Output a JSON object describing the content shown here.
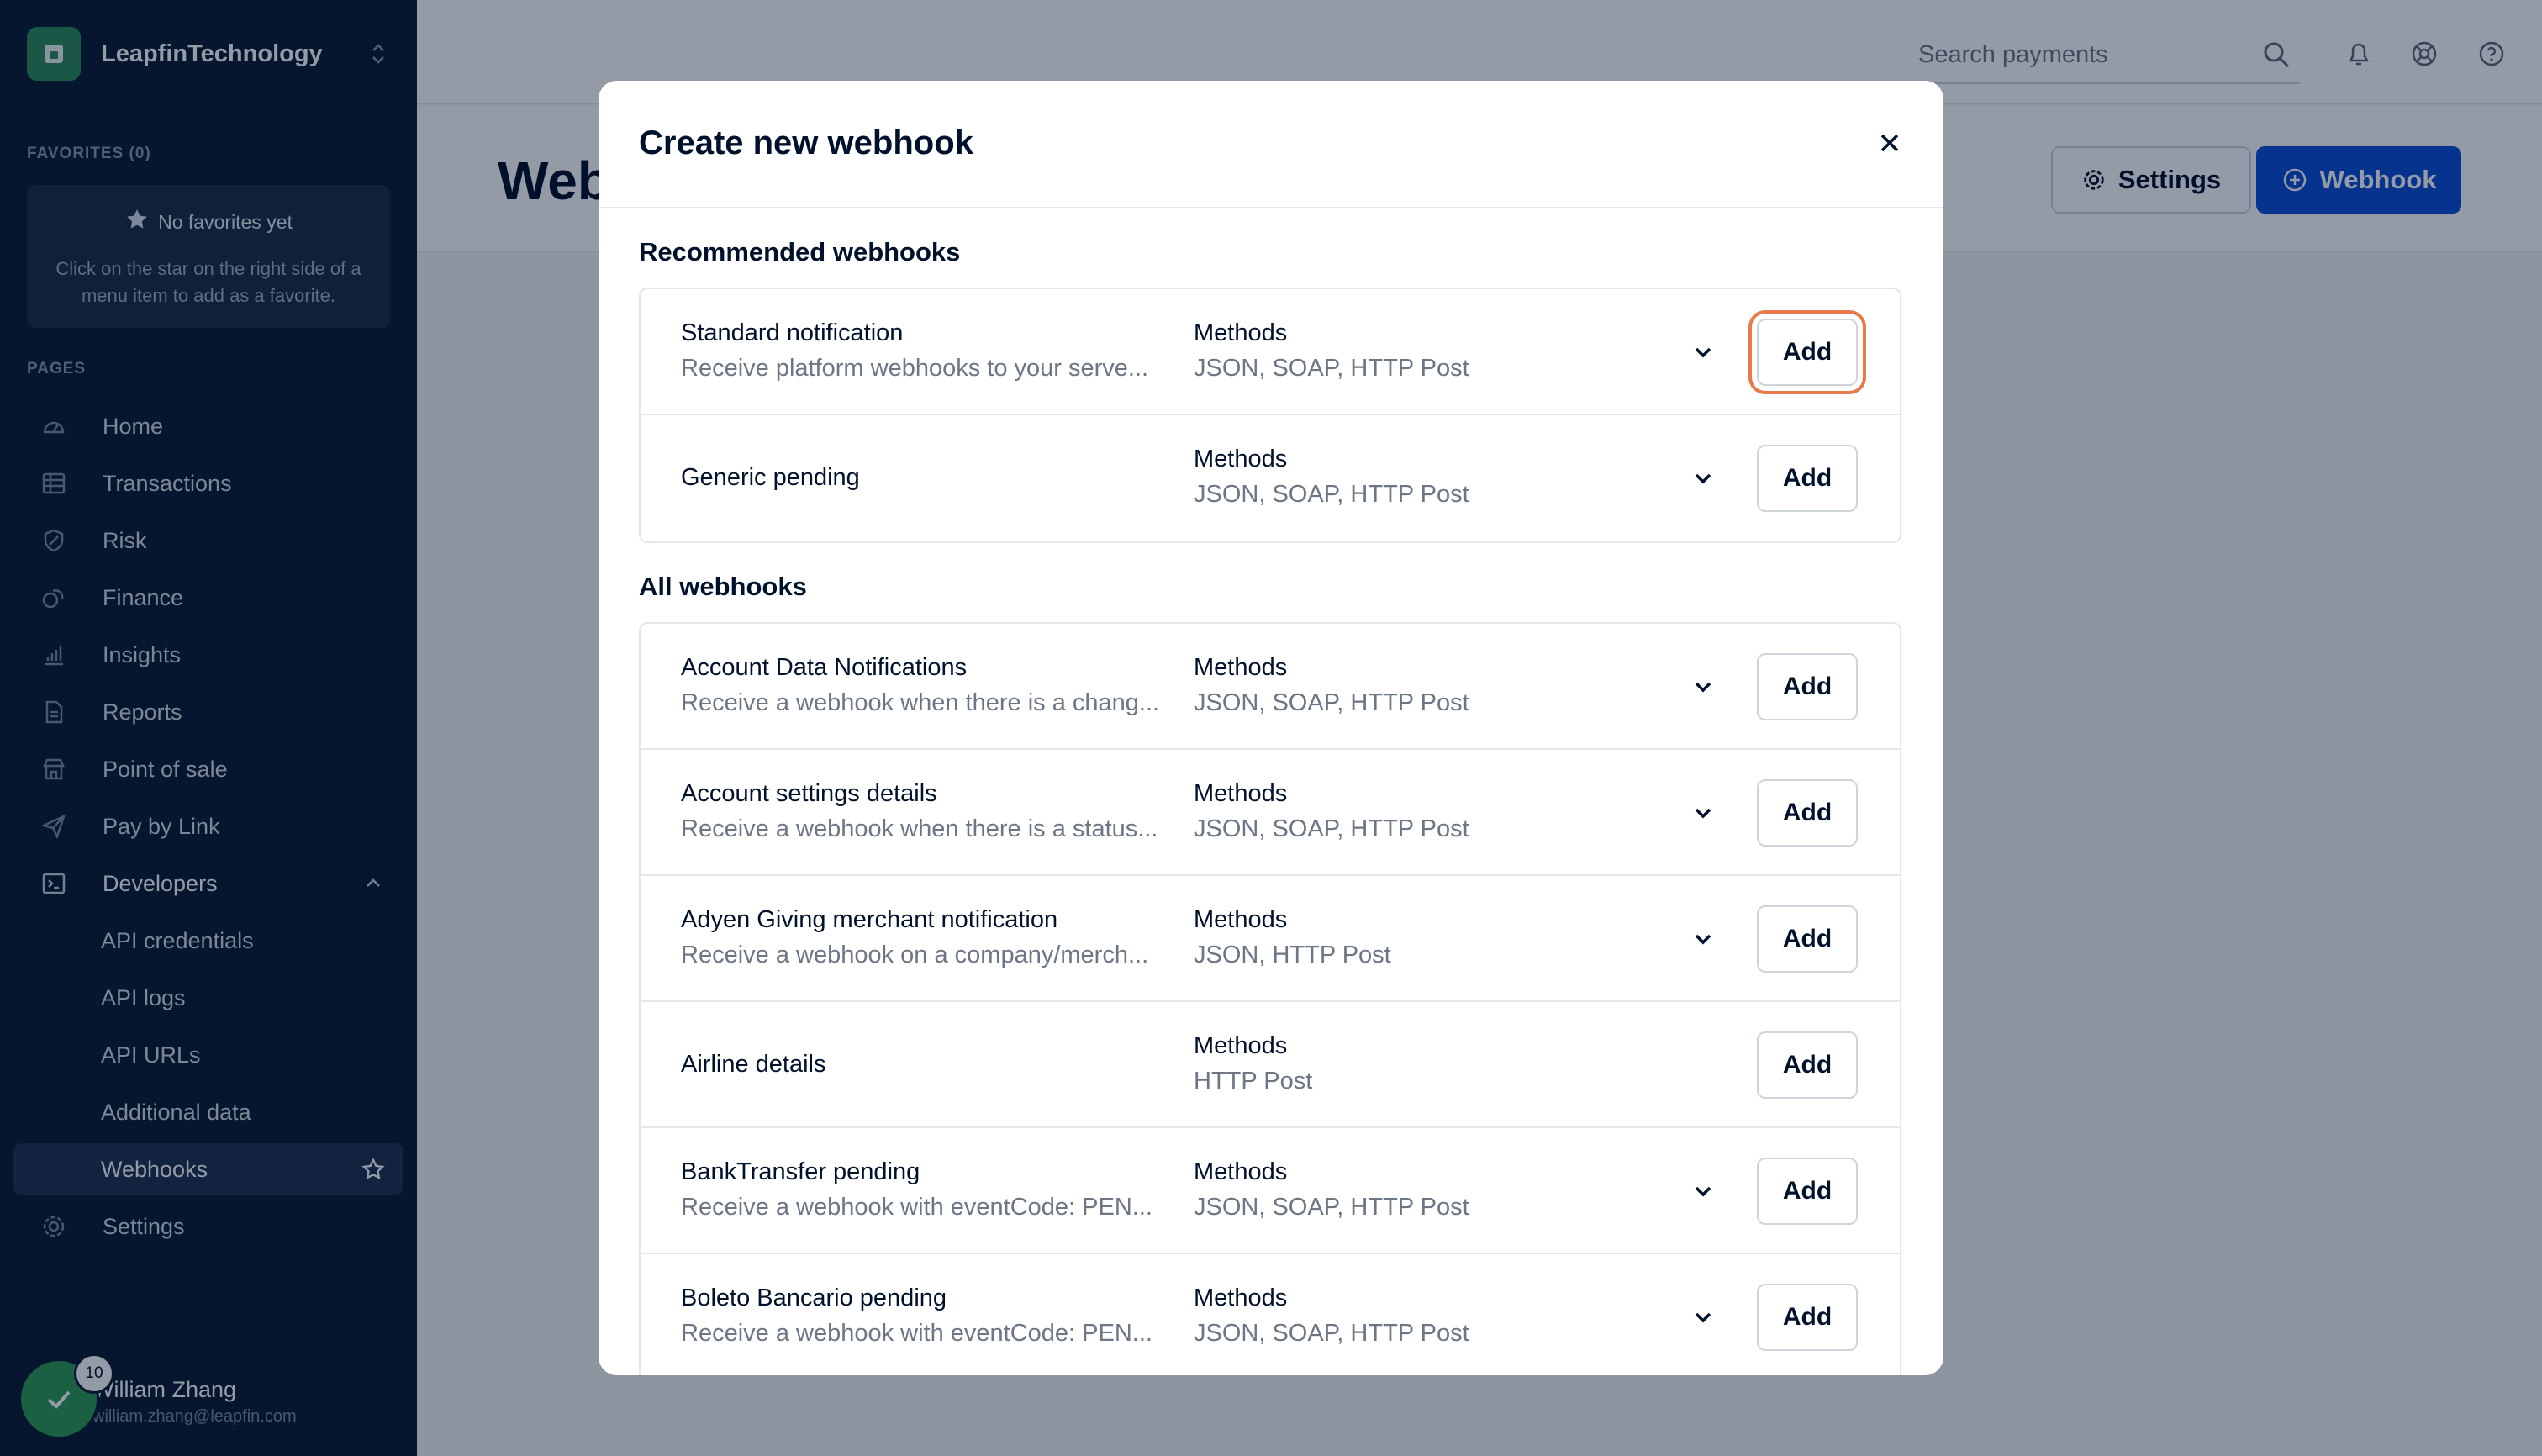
{
  "sidebar": {
    "org_name": "LeapfinTechnology",
    "favorites_label": "FAVORITES (0)",
    "favorites_empty_title": "No favorites yet",
    "favorites_empty_desc": "Click on the star on the right side of a menu item to add as a favorite.",
    "pages_label": "PAGES",
    "items": [
      {
        "label": "Home",
        "icon": "speedometer-icon"
      },
      {
        "label": "Transactions",
        "icon": "table-icon"
      },
      {
        "label": "Risk",
        "icon": "shield-icon"
      },
      {
        "label": "Finance",
        "icon": "coins-icon"
      },
      {
        "label": "Insights",
        "icon": "bar-chart-icon"
      },
      {
        "label": "Reports",
        "icon": "document-icon"
      },
      {
        "label": "Point of sale",
        "icon": "store-icon"
      },
      {
        "label": "Pay by Link",
        "icon": "paper-plane-icon"
      },
      {
        "label": "Developers",
        "icon": "terminal-icon"
      }
    ],
    "developer_subitems": [
      "API credentials",
      "API logs",
      "API URLs",
      "Additional data",
      "Webhooks"
    ],
    "settings_label": "Settings",
    "user": {
      "name": "William Zhang",
      "email": "william.zhang@leapfin.com",
      "task_count": "10"
    }
  },
  "topbar": {
    "search_placeholder": "Search payments"
  },
  "page": {
    "title": "Webhooks",
    "settings_button": "Settings",
    "webhook_button": "Webhook"
  },
  "modal": {
    "title": "Create new webhook",
    "recommended_title": "Recommended webhooks",
    "all_title": "All webhooks",
    "methods_label": "Methods",
    "add_label": "Add",
    "recommended": [
      {
        "name": "Standard notification",
        "desc": "Receive platform webhooks to your serve...",
        "methods": "JSON, SOAP, HTTP Post",
        "expandable": true
      },
      {
        "name": "Generic pending",
        "desc": "",
        "methods": "JSON, SOAP, HTTP Post",
        "expandable": true
      }
    ],
    "all": [
      {
        "name": "Account Data Notifications",
        "desc": "Receive a webhook when there is a chang...",
        "methods": "JSON, SOAP, HTTP Post",
        "expandable": true
      },
      {
        "name": "Account settings details",
        "desc": "Receive a webhook when there is a status...",
        "methods": "JSON, SOAP, HTTP Post",
        "expandable": true
      },
      {
        "name": "Adyen Giving merchant notification",
        "desc": "Receive a webhook on a company/merch...",
        "methods": "JSON, HTTP Post",
        "expandable": true
      },
      {
        "name": "Airline details",
        "desc": "",
        "methods": "HTTP Post",
        "expandable": false
      },
      {
        "name": "BankTransfer pending",
        "desc": "Receive a webhook with eventCode: PEN...",
        "methods": "JSON, SOAP, HTTP Post",
        "expandable": true
      },
      {
        "name": "Boleto Bancario pending",
        "desc": "Receive a webhook with eventCode: PEN...",
        "methods": "JSON, SOAP, HTTP Post",
        "expandable": true
      }
    ]
  },
  "colors": {
    "sidebar_bg": "#0b1a33",
    "primary": "#0a4dd6",
    "focus_ring": "#e8794a",
    "success": "#2f9a55"
  }
}
